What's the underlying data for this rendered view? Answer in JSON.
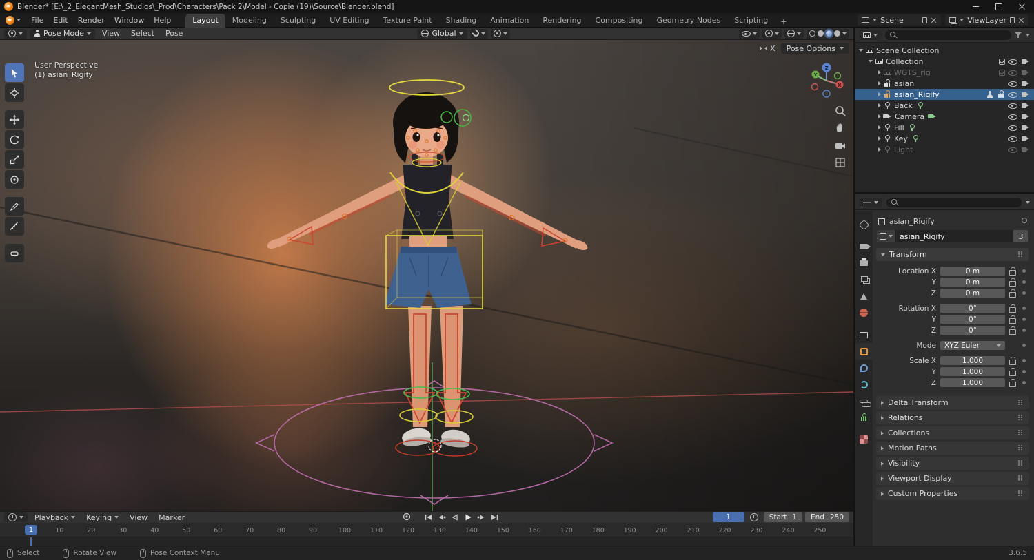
{
  "titlebar": {
    "title": "Blender* [E:\\_2_ElegantMesh_Studios\\_Prod\\Characters\\Pack 2\\Model - Copie (19)\\Source\\Blender.blend]"
  },
  "menubar": {
    "menus": [
      "File",
      "Edit",
      "Render",
      "Window",
      "Help"
    ],
    "workspaces": [
      "Layout",
      "Modeling",
      "Sculpting",
      "UV Editing",
      "Texture Paint",
      "Shading",
      "Animation",
      "Rendering",
      "Compositing",
      "Geometry Nodes",
      "Scripting"
    ],
    "active_workspace": "Layout",
    "add_workspace": "+",
    "scene_label": "Scene",
    "viewlayer_label": "ViewLayer"
  },
  "viewport": {
    "header": {
      "mode": "Pose Mode",
      "menus": [
        "View",
        "Select",
        "Pose"
      ],
      "orientation": "Global"
    },
    "pose_options_label": "Pose Options",
    "mirror_x_label": "X",
    "overlay_line1": "User Perspective",
    "overlay_line2": "(1) asian_Rigify",
    "gizmo": {
      "x": "X",
      "y": "Y",
      "z": "Z"
    }
  },
  "outliner": {
    "rows": [
      {
        "label": "Scene Collection",
        "icon": "scene-collection"
      },
      {
        "label": "Collection",
        "icon": "collection"
      },
      {
        "label": "WGTS_rig",
        "icon": "collection",
        "muted": true
      },
      {
        "label": "asian",
        "icon": "armature"
      },
      {
        "label": "asian_Rigify",
        "icon": "armature",
        "selected": true
      },
      {
        "label": "Back",
        "icon": "light"
      },
      {
        "label": "Camera",
        "icon": "camera"
      },
      {
        "label": "Fill",
        "icon": "light"
      },
      {
        "label": "Key",
        "icon": "light"
      },
      {
        "label": "Light",
        "icon": "light",
        "muted": true
      }
    ]
  },
  "properties": {
    "breadcrumb": "asian_Rigify",
    "name_value": "asian_Rigify",
    "users_count": "3",
    "transform": {
      "title": "Transform",
      "rows": [
        {
          "label": "Location X",
          "value": "0 m"
        },
        {
          "label": "Y",
          "value": "0 m"
        },
        {
          "label": "Z",
          "value": "0 m"
        },
        {
          "label": "Rotation X",
          "value": "0°"
        },
        {
          "label": "Y",
          "value": "0°"
        },
        {
          "label": "Z",
          "value": "0°"
        },
        {
          "label": "Mode",
          "value": "XYZ Euler"
        },
        {
          "label": "Scale X",
          "value": "1.000"
        },
        {
          "label": "Y",
          "value": "1.000"
        },
        {
          "label": "Z",
          "value": "1.000"
        }
      ]
    },
    "collapsed_panels": [
      "Delta Transform",
      "Relations",
      "Collections",
      "Motion Paths",
      "Visibility",
      "Viewport Display",
      "Custom Properties"
    ]
  },
  "timeline": {
    "menus": [
      "Playback",
      "Keying",
      "View",
      "Marker"
    ],
    "current_frame": "1",
    "start_label": "Start",
    "start_value": "1",
    "end_label": "End",
    "end_value": "250",
    "ruler_labels": [
      10,
      20,
      30,
      40,
      50,
      60,
      70,
      80,
      90,
      100,
      110,
      120,
      130,
      140,
      150,
      160,
      170,
      180,
      190,
      200,
      210,
      220,
      230,
      240,
      250
    ]
  },
  "statusbar": {
    "left_hints": [
      "Select",
      "Rotate View",
      "Pose Context Menu"
    ],
    "version": "3.6.5"
  }
}
